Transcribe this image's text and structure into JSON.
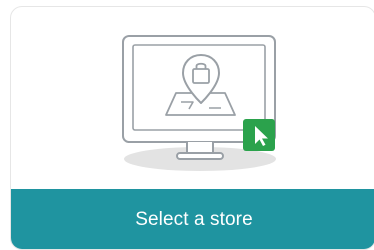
{
  "card": {
    "action_label": "Select a store",
    "illustration_icon": "monitor-store-location-icon",
    "cursor_badge_icon": "cursor-arrow-icon"
  },
  "colors": {
    "accent": "#1f94a0",
    "badge": "#2ba24c",
    "line_art": "#9aa0a6",
    "shadow": "#e3e3e3",
    "border": "#e6e6e6"
  }
}
